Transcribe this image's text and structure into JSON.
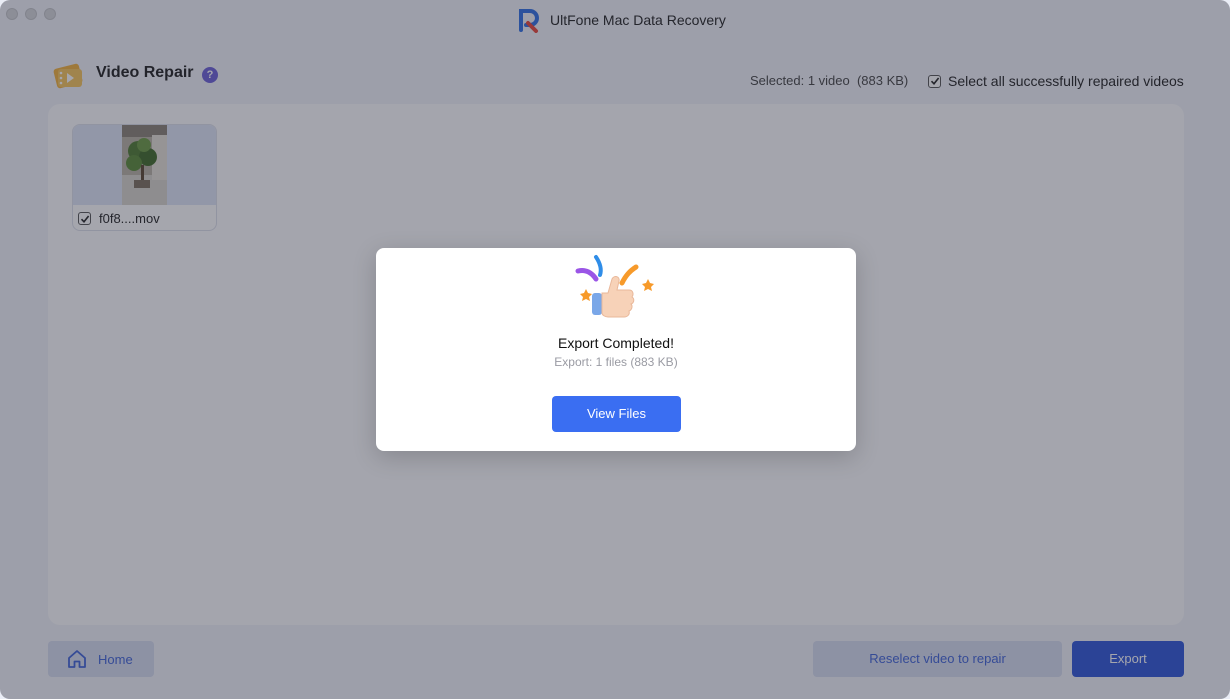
{
  "window": {
    "app_title": "UltFone Mac Data Recovery"
  },
  "header": {
    "title": "Video Repair",
    "help_icon": "question-mark-icon",
    "selected_info": "Selected: 1 video  (883 KB)",
    "select_all_label": "Select all successfully repaired videos",
    "select_all_checked": true
  },
  "videos": [
    {
      "name": "f0f8....mov",
      "checked": true
    }
  ],
  "footer": {
    "home_label": "Home",
    "reselect_label": "Reselect video to repair",
    "export_label": "Export"
  },
  "dialog": {
    "title": "Export Completed!",
    "subtitle": "Export: 1 files (883 KB)",
    "view_files_label": "View Files"
  },
  "colors": {
    "accent": "#3a6ef2",
    "export_button": "#2d55d8",
    "help_badge": "#6b5fd8"
  }
}
